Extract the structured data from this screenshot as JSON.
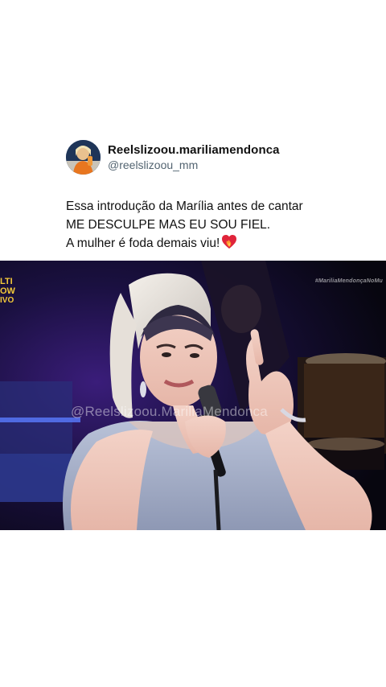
{
  "post": {
    "display_name": "Reelslizoou.mariliamendonca",
    "handle": "@reelslizoou_mm",
    "text_lines": [
      "Essa introdução da Marília antes de cantar",
      "ME DESCULPE MAS EU SOU FIEL.",
      "A mulher é foda demais viu!"
    ],
    "emoji": "❤️‍🔥"
  },
  "video": {
    "channel_logo": [
      "LTI",
      "OW",
      "IVO"
    ],
    "corner_tag": "#MariliaMendonçaNoMu",
    "watermark": "@Reelslizoou.MariliaMendonca"
  },
  "icons": {
    "avatar": "profile-avatar",
    "emoji": "heart-on-fire-icon"
  },
  "colors": {
    "background": "#ffffff",
    "text": "#111111",
    "handle": "#536471",
    "logo": "#f2c83a"
  }
}
